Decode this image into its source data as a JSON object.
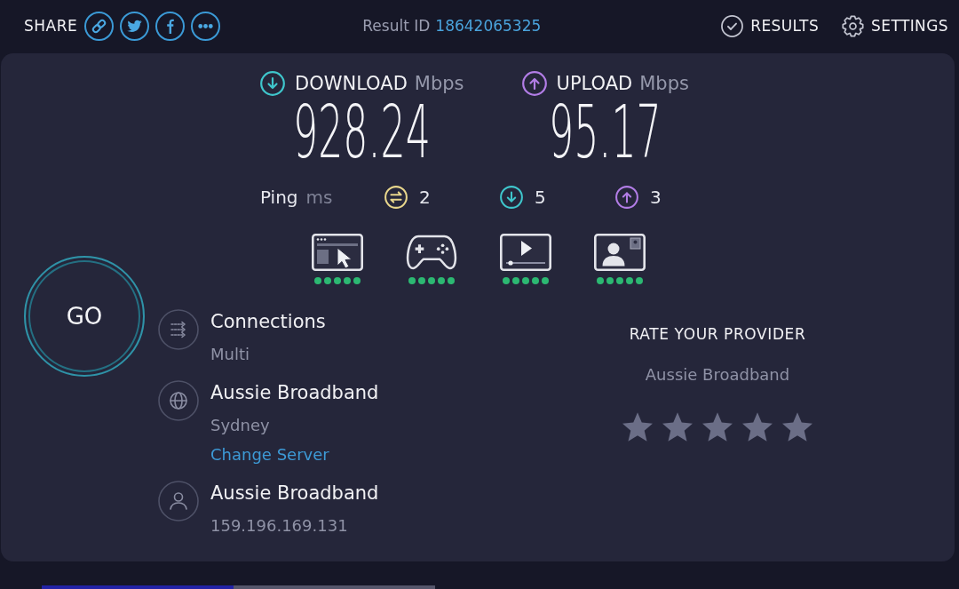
{
  "header": {
    "share_label": "SHARE",
    "share_buttons": [
      {
        "kind": "link"
      },
      {
        "kind": "twitter"
      },
      {
        "kind": "facebook"
      },
      {
        "kind": "more"
      }
    ],
    "result_label": "Result ID",
    "result_id": "18642065325",
    "nav": [
      {
        "kind": "results",
        "label": "RESULTS"
      },
      {
        "kind": "settings",
        "label": "SETTINGS"
      }
    ]
  },
  "speeds": [
    {
      "kind": "download",
      "label": "DOWNLOAD",
      "unit": "Mbps",
      "value": "928.24"
    },
    {
      "kind": "upload",
      "label": "UPLOAD",
      "unit": "Mbps",
      "value": "95.17"
    }
  ],
  "ping": {
    "label": "Ping",
    "unit": "ms",
    "items": [
      {
        "kind": "idle",
        "value": "2"
      },
      {
        "kind": "download",
        "value": "5"
      },
      {
        "kind": "upload",
        "value": "3"
      }
    ]
  },
  "activities": [
    {
      "kind": "browsing",
      "stars": 5
    },
    {
      "kind": "gaming",
      "stars": 5
    },
    {
      "kind": "streaming",
      "stars": 5
    },
    {
      "kind": "video_call",
      "stars": 5
    }
  ],
  "go_button": {
    "label": "GO"
  },
  "info": [
    {
      "kind": "connections",
      "title": "Connections",
      "subtitle": "Multi"
    },
    {
      "kind": "server",
      "title": "Aussie Broadband",
      "subtitle": "Sydney",
      "link": "Change Server"
    },
    {
      "kind": "provider",
      "title": "Aussie Broadband",
      "subtitle": "159.196.169.131"
    }
  ],
  "rating": {
    "title": "RATE YOUR PROVIDER",
    "provider": "Aussie Broadband"
  }
}
